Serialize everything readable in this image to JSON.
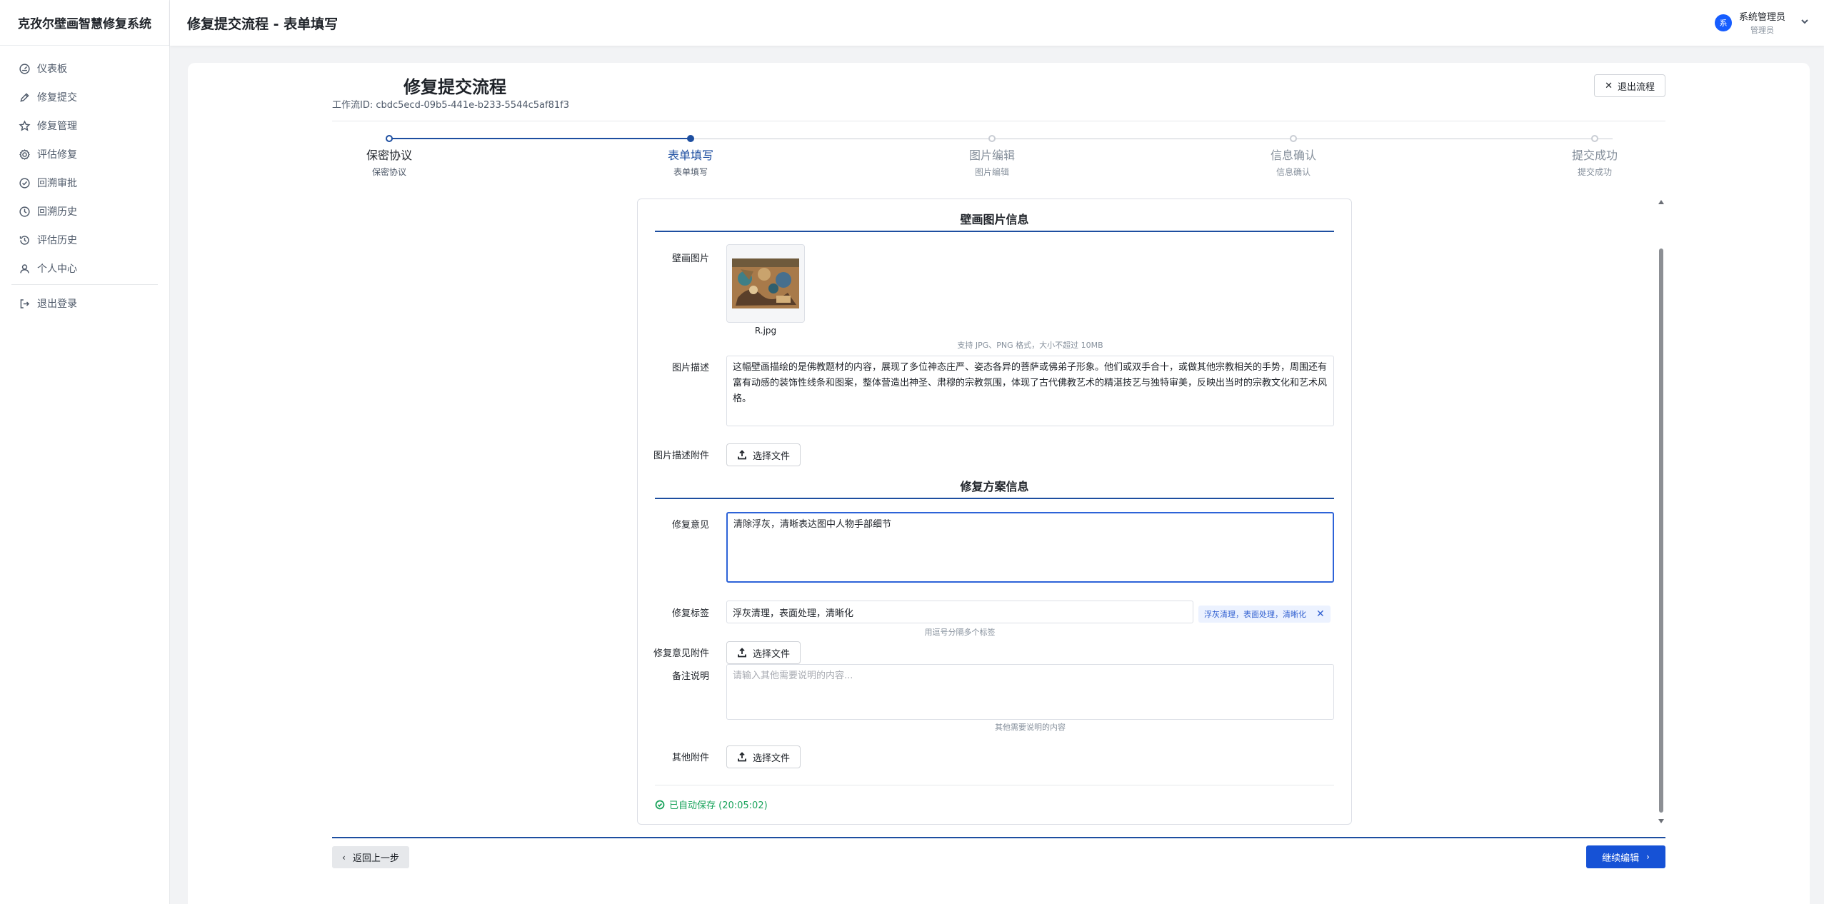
{
  "app": {
    "name": "克孜尔壁画智慧修复系统",
    "header_title": "修复提交流程 - 表单填写"
  },
  "sidebar": {
    "items": [
      {
        "label": "仪表板",
        "icon": "dashboard-icon"
      },
      {
        "label": "修复提交",
        "icon": "pencil-icon"
      },
      {
        "label": "修复管理",
        "icon": "star-icon"
      },
      {
        "label": "评估修复",
        "icon": "gear-icon"
      },
      {
        "label": "回溯审批",
        "icon": "check-circle-icon"
      },
      {
        "label": "回溯历史",
        "icon": "clock-icon"
      },
      {
        "label": "评估历史",
        "icon": "history-icon"
      },
      {
        "label": "个人中心",
        "icon": "user-icon"
      }
    ],
    "logout_label": "退出登录"
  },
  "user": {
    "avatar_text": "系",
    "name": "系统管理员",
    "role": "管理员"
  },
  "flow": {
    "title": "修复提交流程",
    "workflow_id": "工作流ID: cbdc5ecd-09b5-441e-b233-5544c5af81f3",
    "exit_label": "退出流程"
  },
  "steps": [
    {
      "title": "保密协议",
      "sub": "保密协议",
      "status": "done"
    },
    {
      "title": "表单填写",
      "sub": "表单填写",
      "status": "active"
    },
    {
      "title": "图片编辑",
      "sub": "图片编辑",
      "status": "pending"
    },
    {
      "title": "信息确认",
      "sub": "信息确认",
      "status": "pending"
    },
    {
      "title": "提交成功",
      "sub": "提交成功",
      "status": "pending"
    }
  ],
  "form": {
    "section1_title": "壁画图片信息",
    "image_label": "壁画图片",
    "image_name": "R.jpg",
    "image_hint": "支持 JPG、PNG 格式，大小不超过 10MB",
    "desc_label": "图片描述",
    "desc_value": "这幅壁画描绘的是佛教题材的内容，展现了多位神态庄严、姿态各异的菩萨或佛弟子形象。他们或双手合十，或做其他宗教相关的手势，周围还有富有动感的装饰性线条和图案，整体营造出神圣、肃穆的宗教氛围，体现了古代佛教艺术的精湛技艺与独特审美，反映出当时的宗教文化和艺术风格。",
    "desc_attach_label": "图片描述附件",
    "choose_file_label": "选择文件",
    "section2_title": "修复方案信息",
    "opinion_label": "修复意见",
    "opinion_value": "清除浮灰，清晰表达图中人物手部细节",
    "tags_label": "修复标签",
    "tags_value": "浮灰清理，表面处理，清晰化",
    "tag_chip": "浮灰清理，表面处理，清晰化",
    "tags_hint": "用逗号分隔多个标签",
    "opinion_attach_label": "修复意见附件",
    "notes_label": "备注说明",
    "notes_placeholder": "请输入其他需要说明的内容...",
    "notes_hint": "其他需要说明的内容",
    "other_attach_label": "其他附件",
    "autosave": "已自动保存 (20:05:02)"
  },
  "footer": {
    "back_label": "返回上一步",
    "next_label": "继续编辑"
  },
  "colors": {
    "primary": "#1652d6",
    "accent_line": "#1d4ea0",
    "success": "#19a35b"
  }
}
